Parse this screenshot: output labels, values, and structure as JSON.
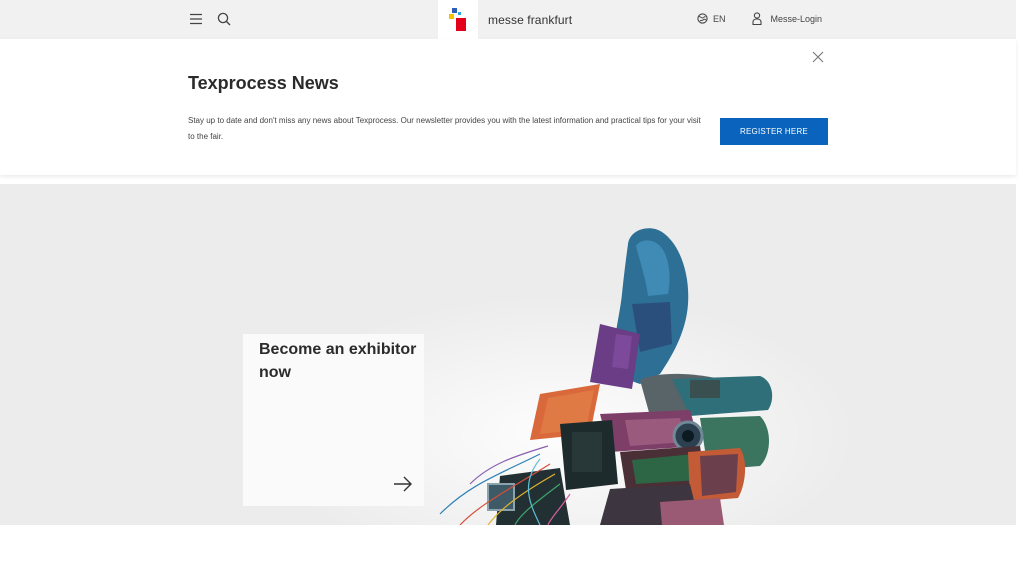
{
  "header": {
    "brand": "messe frankfurt",
    "language": "EN",
    "login": "Messe-Login",
    "icons": [
      "menu-icon",
      "search-icon",
      "globe-icon",
      "user-icon"
    ]
  },
  "newsletter": {
    "title": "Texprocess News",
    "text": "Stay up to date and don't miss any news about Texprocess. Our newsletter provides you with the latest information and practical tips for your visit to the fair.",
    "button": "REGISTER HERE"
  },
  "hero": {
    "card_title": "Become an exhibitor now"
  },
  "colors": {
    "accent": "#0a64bd",
    "topbar": "#f1f1f1",
    "hero_bg": "#ebeceb"
  }
}
